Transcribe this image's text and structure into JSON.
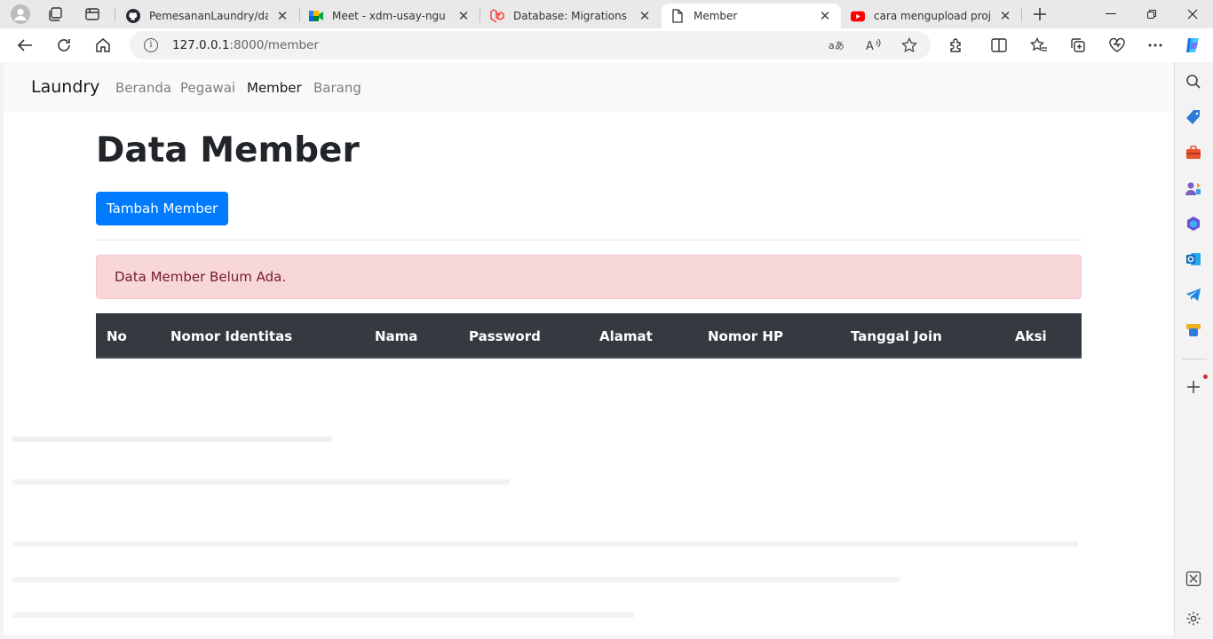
{
  "browser": {
    "tabs": [
      {
        "title": "PemesananLaundry/datab",
        "icon": "github-icon",
        "active": false
      },
      {
        "title": "Meet - xdm-usay-ngu",
        "icon": "google-meet-icon",
        "active": false
      },
      {
        "title": "Database: Migrations - Lar",
        "icon": "laravel-icon",
        "active": false
      },
      {
        "title": "Member",
        "icon": "page-icon",
        "active": true
      },
      {
        "title": "cara mengupload project",
        "icon": "youtube-icon",
        "active": false
      }
    ],
    "url_host": "127.0.0.1",
    "url_rest": ":8000/member",
    "colors": {
      "youtube": "#ff0000",
      "laravel": "#ff2d20",
      "edge": "#0f6cbd"
    }
  },
  "navbar": {
    "brand": "Laundry",
    "links": [
      "Beranda",
      "Pegawai",
      "Member",
      "Barang"
    ],
    "active_index": 2
  },
  "main": {
    "title": "Data Member",
    "add_button": "Tambah Member",
    "alert": "Data Member Belum Ada.",
    "table_headers": [
      "No",
      "Nomor Identitas",
      "Nama",
      "Password",
      "Alamat",
      "Nomor HP",
      "Tanggal Join",
      "Aksi"
    ]
  },
  "theme": {
    "primary": "#007bff",
    "alert_bg": "#f8d7da",
    "alert_text": "#721c24",
    "table_head_bg": "#343a40"
  }
}
